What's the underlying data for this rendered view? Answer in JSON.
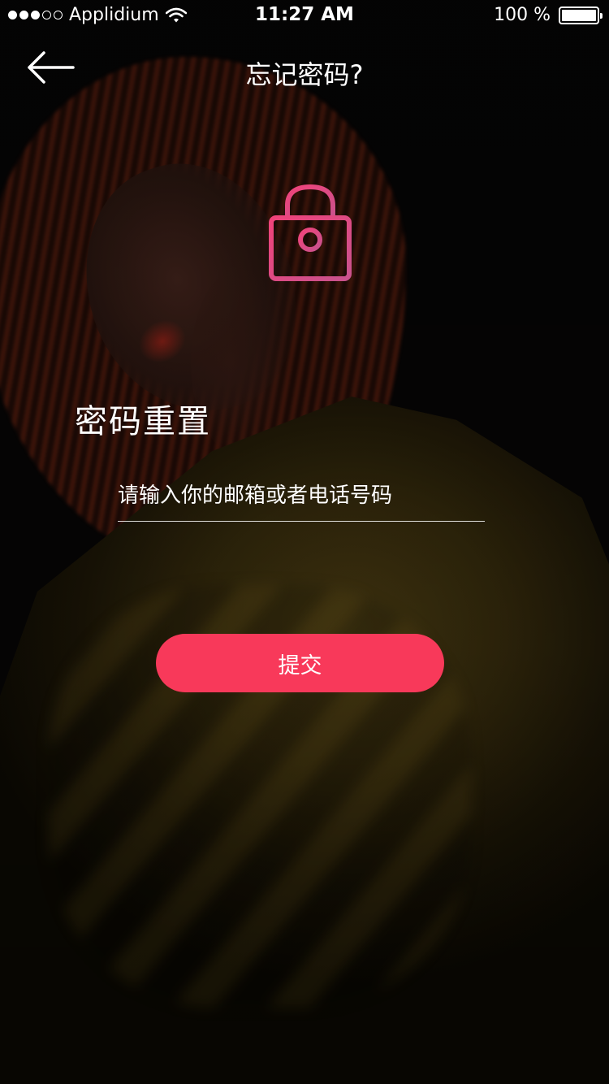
{
  "status_bar": {
    "carrier": "Applidium",
    "signal_dots_filled": 3,
    "signal_dots_total": 5,
    "time": "11:27 AM",
    "battery_text": "100 %",
    "battery_level": 1.0
  },
  "nav": {
    "title": "忘记密码?",
    "back_icon": "arrow-left-icon"
  },
  "hero": {
    "icon": "lock-icon",
    "icon_gradient": [
      "#f0437a",
      "#d3588f"
    ]
  },
  "form": {
    "title": "密码重置",
    "contact_placeholder": "请输入你的邮箱或者电话号码",
    "contact_value": "",
    "submit_label": "提交"
  },
  "colors": {
    "accent": "#f8395a",
    "text": "#ffffff",
    "background": "#000000"
  }
}
